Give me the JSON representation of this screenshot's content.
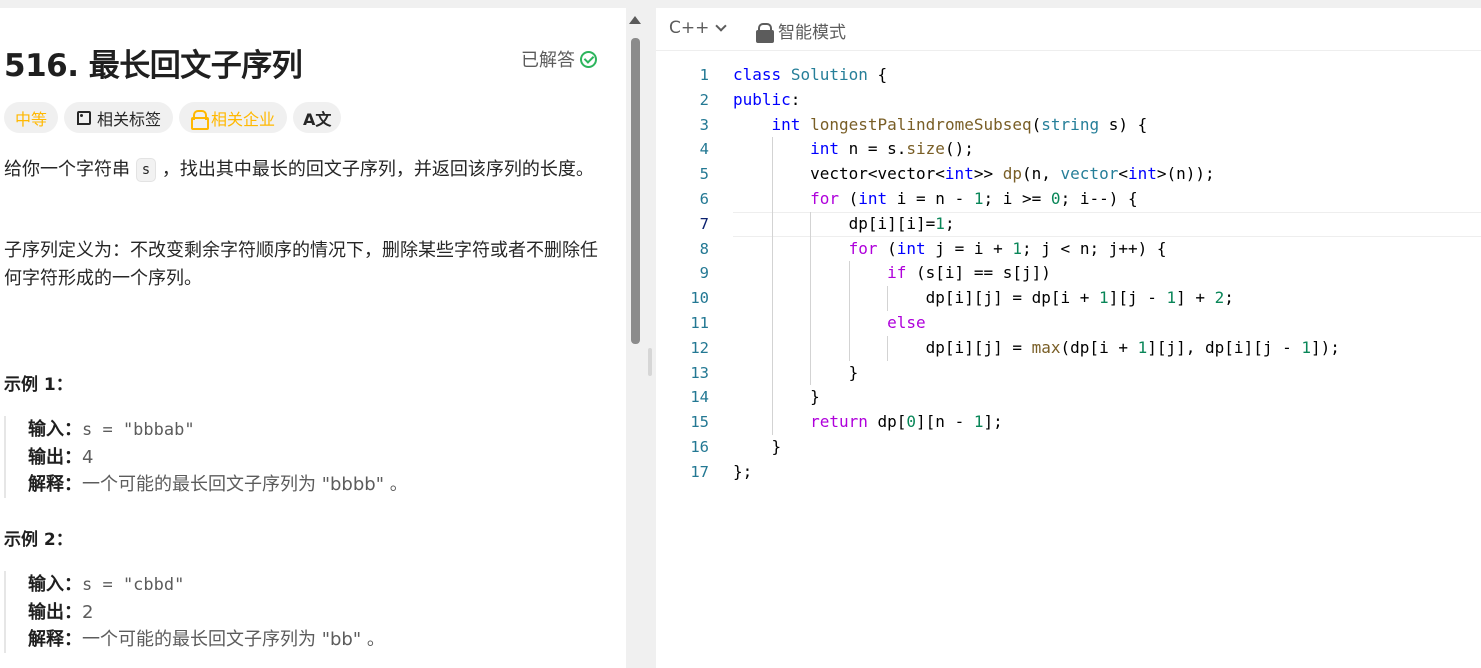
{
  "problem": {
    "title": "516. 最长回文子序列",
    "status": "已解答",
    "tags": {
      "difficulty": "中等",
      "related_tags": "相关标签",
      "related_companies": "相关企业",
      "translate": "A文"
    },
    "description_before": "给你一个字符串",
    "description_code": "s",
    "description_after": "，找出其中最长的回文子序列，并返回该序列的长度。",
    "definition": "子序列定义为：不改变剩余字符顺序的情况下，删除某些字符或者不删除任何字符形成的一个序列。",
    "examples": [
      {
        "title": "示例 1：",
        "input_label": "输入：",
        "input": "s = \"bbbab\"",
        "output_label": "输出：",
        "output": "4",
        "explain_label": "解释：",
        "explain": "一个可能的最长回文子序列为 \"bbbb\" 。"
      },
      {
        "title": "示例 2：",
        "input_label": "输入：",
        "input": "s = \"cbbd\"",
        "output_label": "输出：",
        "output": "2",
        "explain_label": "解释：",
        "explain": "一个可能的最长回文子序列为 \"bb\" 。"
      }
    ]
  },
  "editor": {
    "language": "C++",
    "mode": "智能模式",
    "active_line": 7,
    "lines": [
      "class Solution {",
      "public:",
      "    int longestPalindromeSubseq(string s) {",
      "        int n = s.size();",
      "        vector<vector<int>> dp(n, vector<int>(n));",
      "        for (int i = n - 1; i >= 0; i--) {",
      "            dp[i][i]=1;",
      "            for (int j = i + 1; j < n; j++) {",
      "                if (s[i] == s[j])",
      "                    dp[i][j] = dp[i + 1][j - 1] + 2;",
      "                else",
      "                    dp[i][j] = max(dp[i + 1][j], dp[i][j - 1]);",
      "            }",
      "        }",
      "        return dp[0][n - 1];",
      "    }",
      "};"
    ]
  }
}
